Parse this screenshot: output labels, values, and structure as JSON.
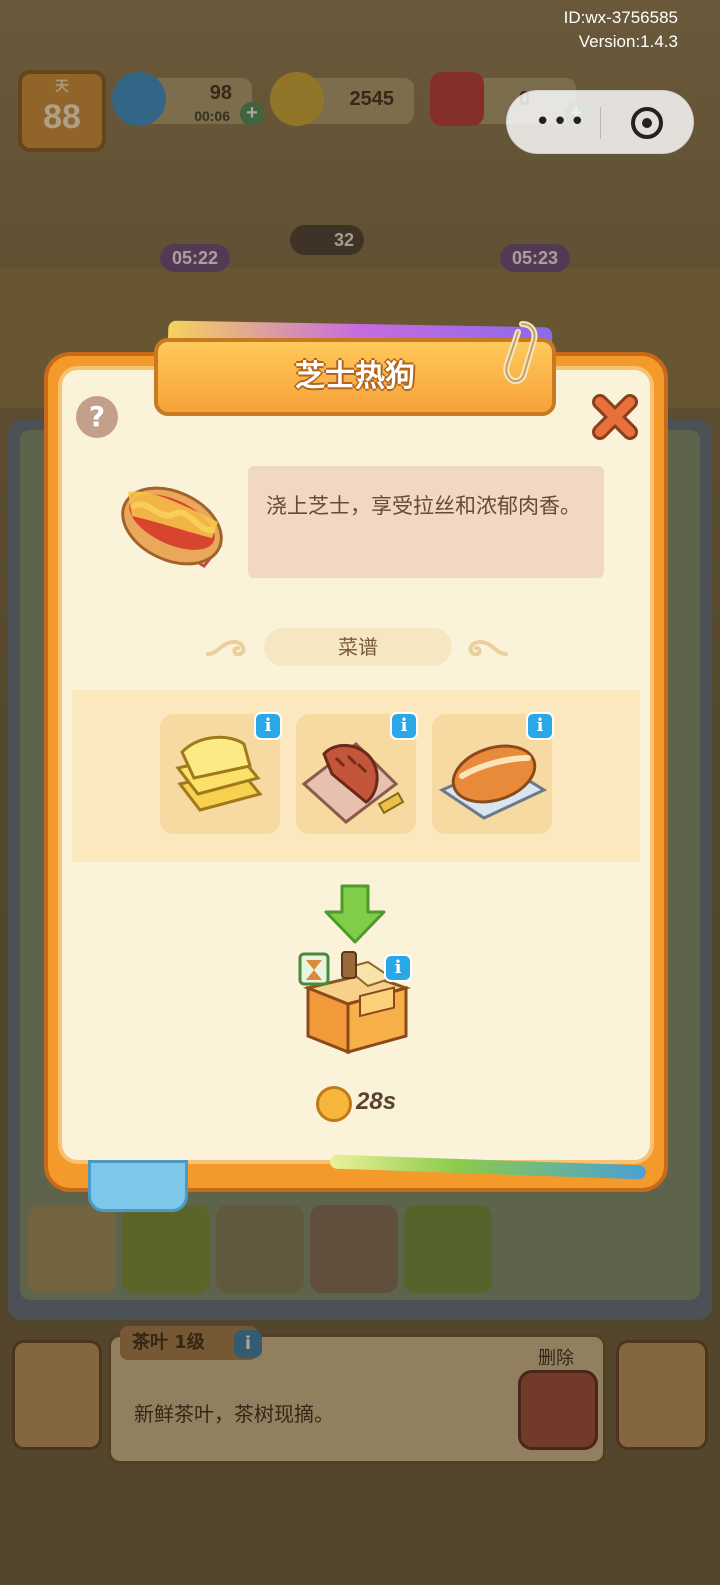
{
  "meta": {
    "id": "ID:wx-3756585",
    "version": "Version:1.4.3"
  },
  "hud": {
    "day_label": "天",
    "day": "88",
    "energy": "98",
    "energy_timer": "00:06",
    "coins": "2545",
    "gems": "0",
    "plus": "+"
  },
  "capsule": {
    "more": "•••"
  },
  "background": {
    "timers": [
      "05:22",
      "05:23"
    ],
    "item_count": "32"
  },
  "modal": {
    "title": "芝士热狗",
    "help": "?",
    "description": "浇上芝士，享受拉丝和浓郁肉香。",
    "recipe_label": "菜谱",
    "ingredients": [
      {
        "name": "cheese-slices"
      },
      {
        "name": "sausage-skewer"
      },
      {
        "name": "bread-roll"
      }
    ],
    "info_glyph": "i",
    "cook_time": "28s"
  },
  "bottom": {
    "item_title": "茶叶 1级",
    "item_desc": "新鲜茶叶，茶树现摘。",
    "delete_label": "删除"
  },
  "colors": {
    "modal_orange": "#f39a2a",
    "modal_cream": "#fbf3d9",
    "info_blue": "#2aa7e6",
    "desc_bg": "#f0d8c4"
  }
}
